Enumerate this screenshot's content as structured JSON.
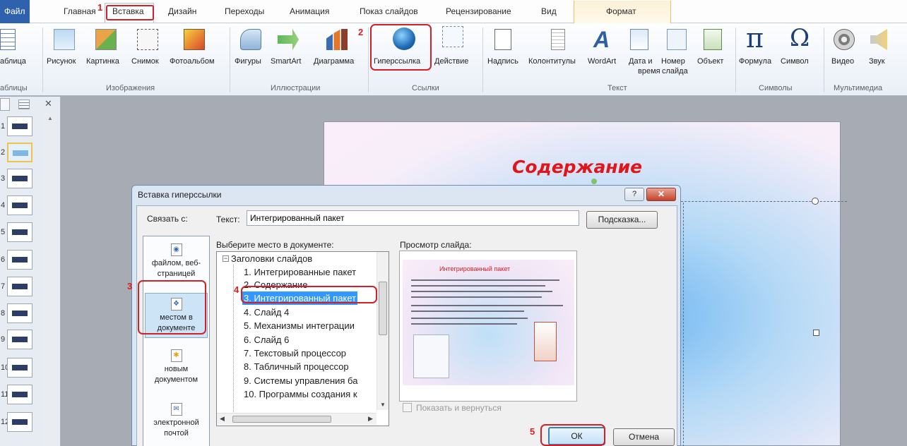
{
  "tabs": {
    "file": "Файл",
    "items": [
      "Главная",
      "Вставка",
      "Дизайн",
      "Переходы",
      "Анимация",
      "Показ слайдов",
      "Рецензирование",
      "Вид",
      "Формат"
    ]
  },
  "ribbon": {
    "buttons": [
      "аблица",
      "Рисунок",
      "Картинка",
      "Снимок",
      "Фотоальбом",
      "Фигуры",
      "SmartArt",
      "Диаграмма",
      "Гиперссылка",
      "Действие",
      "Надпись",
      "Колонтитулы",
      "WordArt",
      "Дата и",
      "время",
      "Номер",
      "слайда",
      "Объект",
      "Формула",
      "Символ",
      "Видео",
      "Звук"
    ],
    "groups": [
      "аблицы",
      "Изображения",
      "Иллюстрации",
      "Ссылки",
      "Текст",
      "Символы",
      "Мультимедиа"
    ]
  },
  "thumbnails": {
    "numbers": [
      "1",
      "2",
      "3",
      "4",
      "5",
      "6",
      "7",
      "8",
      "9",
      "10",
      "11",
      "12"
    ]
  },
  "slide": {
    "title": "Содержание"
  },
  "dialog": {
    "title": "Вставка гиперссылки",
    "help": "?",
    "link_to": "Связать с:",
    "link_options": [
      {
        "line1": "файлом, веб-",
        "line2": "страницей"
      },
      {
        "line1": "местом в",
        "line2": "документе"
      },
      {
        "line1": "новым",
        "line2": "документом"
      },
      {
        "line1": "электронной",
        "line2": "почтой"
      }
    ],
    "text_label": "Текст:",
    "text_value": "Интегрированный пакет",
    "hint_button": "Подсказка...",
    "place_label": "Выберите место в документе:",
    "tree": [
      "Заголовки слайдов",
      "1. Интегрированные пакет",
      "2. Содержание",
      "3. Интегрированный пакет",
      "4. Слайд 4",
      "5. Механизмы интеграции",
      "6. Слайд 6",
      "7. Текстовый процессор",
      "8. Табличный процессор",
      "9. Системы управления ба",
      "10. Программы создания к"
    ],
    "preview_label": "Просмотр слайда:",
    "preview_title": "Интегрированный пакет",
    "show_and_return": "Показать и вернуться",
    "ok": "ОК",
    "cancel": "Отмена"
  },
  "annotations": [
    "1",
    "2",
    "3",
    "4",
    "5"
  ],
  "colors": {
    "accent_red": "#d21f28",
    "file_tab": "#2f62ad",
    "selection": "#3399ff",
    "slide_title": "#e0161b"
  }
}
